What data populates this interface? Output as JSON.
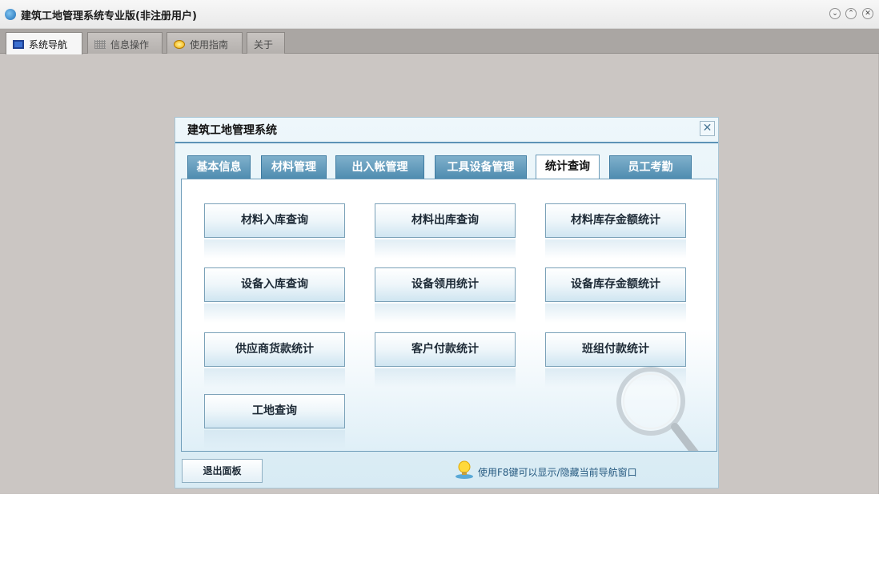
{
  "window": {
    "title": "建筑工地管理系统专业版(非注册用户)",
    "controls": [
      "minimize-icon",
      "restore-icon",
      "close-icon"
    ]
  },
  "main_tabs": [
    {
      "label": "系统导航",
      "icon": "nav-window-icon",
      "active": true
    },
    {
      "label": "信息操作",
      "icon": "grid-icon",
      "active": false
    },
    {
      "label": "使用指南",
      "icon": "help-icon",
      "active": false
    },
    {
      "label": "关于",
      "icon": "",
      "active": false
    }
  ],
  "dialog": {
    "title": "建筑工地管理系统",
    "close_glyph": "✕",
    "tabs": [
      {
        "label": "基本信息",
        "active": false
      },
      {
        "label": "材料管理",
        "active": false
      },
      {
        "label": "出入帐管理",
        "active": false
      },
      {
        "label": "工具设备管理",
        "active": false
      },
      {
        "label": "统计查询",
        "active": true
      },
      {
        "label": "员工考勤",
        "active": false
      }
    ],
    "buttons": [
      "材料入库查询",
      "材料出库查询",
      "材料库存金额统计",
      "设备入库查询",
      "设备领用统计",
      "设备库存金额统计",
      "供应商货款统计",
      "客户付款统计",
      "班组付款统计",
      "工地查询"
    ],
    "exit_label": "退出面板",
    "hint": "使用F8键可以显示/隐藏当前导航窗口",
    "hint_icon": "lightbulb-icon",
    "decor_icon": "magnifier-icon"
  },
  "colors": {
    "app_background": "#cbc6c3",
    "tab_accent": "#4f8cb0",
    "hint_text": "#25597f"
  }
}
